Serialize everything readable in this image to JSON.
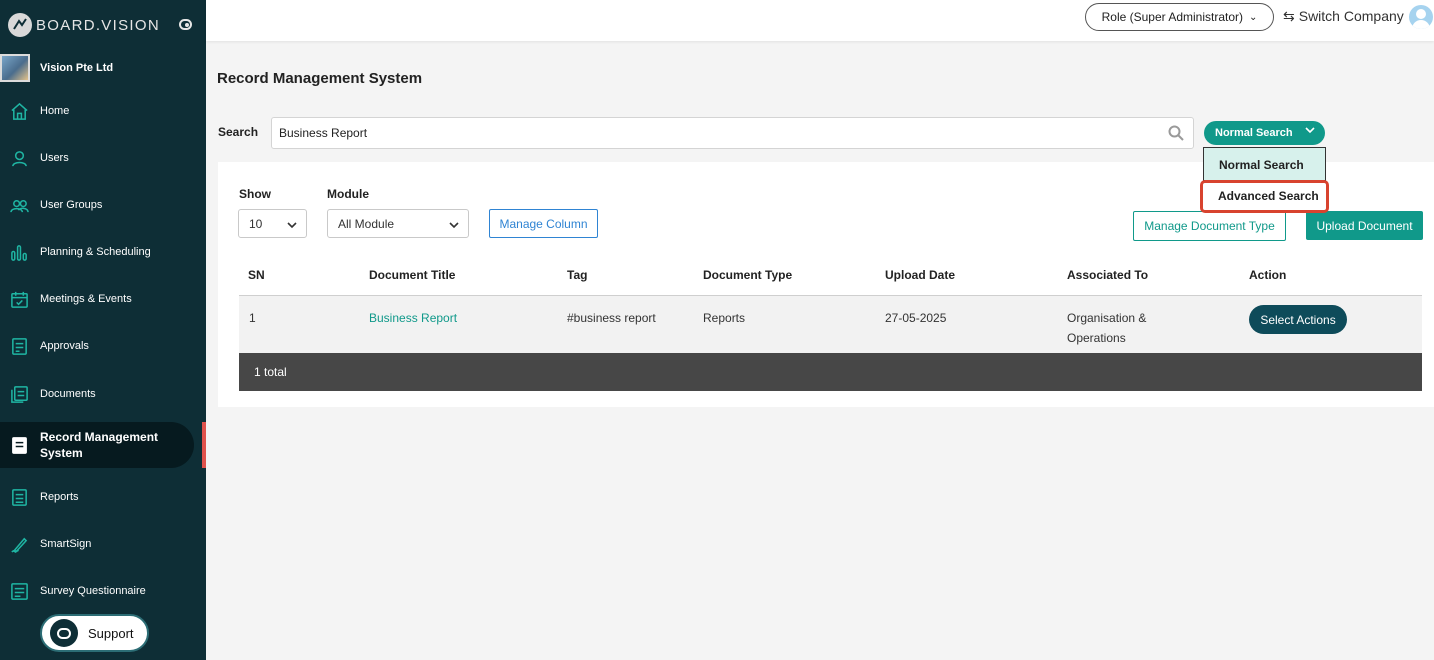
{
  "brand": {
    "name": "BOARD.VISION",
    "logo_icon": "board-vision-logo-icon",
    "toggle_icon": "toggle-icon"
  },
  "company": {
    "name": "Vision Pte Ltd"
  },
  "sidebar": {
    "items": [
      {
        "label": "Home",
        "icon": "home-icon"
      },
      {
        "label": "Users",
        "icon": "user-icon"
      },
      {
        "label": "User Groups",
        "icon": "user-groups-icon"
      },
      {
        "label": "Planning & Scheduling",
        "icon": "bar-chart-icon"
      },
      {
        "label": "Meetings & Events",
        "icon": "calendar-icon"
      },
      {
        "label": "Approvals",
        "icon": "approvals-icon"
      },
      {
        "label": "Documents",
        "icon": "documents-icon"
      },
      {
        "label": "Record Management System",
        "icon": "record-icon",
        "active": true
      },
      {
        "label": "Reports",
        "icon": "reports-icon"
      },
      {
        "label": "SmartSign",
        "icon": "pen-icon"
      },
      {
        "label": "Survey Questionnaire",
        "icon": "survey-icon"
      }
    ],
    "support_label": "Support",
    "active_marker_color": "#e0524c"
  },
  "topbar": {
    "role_label": "Role (Super Administrator)",
    "switch_company_label": "Switch Company"
  },
  "page": {
    "title": "Record Management System",
    "search_label": "Search",
    "search_value": "Business Report",
    "search_mode_label": "Normal Search",
    "search_modes": [
      "Normal Search",
      "Advanced Search"
    ],
    "highlight_color": "#d8432f"
  },
  "controls": {
    "show_label": "Show",
    "show_value": "10",
    "module_label": "Module",
    "module_value": "All Module",
    "manage_column_label": "Manage Column",
    "manage_document_type_label": "Manage Document Type",
    "upload_document_label": "Upload Document"
  },
  "table": {
    "headers": [
      "SN",
      "Document Title",
      "Tag",
      "Document Type",
      "Upload Date",
      "Associated To",
      "Action"
    ],
    "rows": [
      {
        "sn": "1",
        "title": "Business Report",
        "tag": "#business report",
        "type": "Reports",
        "upload_date": "27-05-2025",
        "associated_to": "Organisation & Operations",
        "action_label": "Select Actions"
      }
    ],
    "footer": "1 total"
  },
  "colors": {
    "accent": "#10998a",
    "sidebar_bg": "#0e2e36",
    "link_blue": "#2f84d3"
  }
}
